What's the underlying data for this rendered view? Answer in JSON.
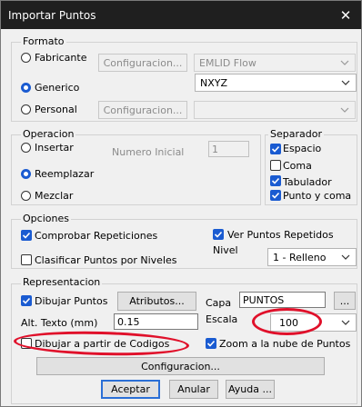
{
  "window": {
    "title": "Importar Puntos",
    "close_glyph": "✕"
  },
  "formato": {
    "title": "Formato",
    "fabricante": {
      "label": "Fabricante",
      "button": "Configuracion...",
      "select": "EMLID Flow"
    },
    "generico": {
      "label": "Generico",
      "select": "NXYZ"
    },
    "personal": {
      "label": "Personal",
      "button": "Configuracion...",
      "select": ""
    }
  },
  "operacion": {
    "title": "Operacion",
    "insertar": "Insertar",
    "reemplazar": "Reemplazar",
    "mezclar": "Mezclar",
    "numero_inicial_label": "Numero Inicial",
    "numero_inicial_value": "1"
  },
  "separador": {
    "title": "Separador",
    "espacio": "Espacio",
    "coma": "Coma",
    "tabulador": "Tabulador",
    "punto_y_coma": "Punto y coma"
  },
  "opciones": {
    "title": "Opciones",
    "comprobar": "Comprobar Repeticiones",
    "ver_repetidos": "Ver Puntos Repetidos",
    "clasificar": "Clasificar Puntos por Niveles",
    "nivel_label": "Nivel",
    "nivel_value": "1 - Relleno"
  },
  "representacion": {
    "title": "Representacion",
    "dibujar_puntos": "Dibujar Puntos",
    "atributos_button": "Atributos...",
    "capa_label": "Capa",
    "capa_value": "PUNTOS",
    "ellipsis_button": "...",
    "alt_texto_label": "Alt. Texto (mm)",
    "alt_texto_value": "0.15",
    "escala_label": "Escala",
    "escala_value": "100",
    "dibujar_codigos": "Dibujar a partir de Codigos",
    "zoom": "Zoom a la nube de Puntos",
    "configuracion_button": "Configuracion..."
  },
  "footer": {
    "aceptar": "Aceptar",
    "anular": "Anular",
    "ayuda": "Ayuda ..."
  },
  "colors": {
    "accent": "#1a5bd1",
    "annotation": "#e0102a",
    "titlebar": "#1f1f1f"
  }
}
